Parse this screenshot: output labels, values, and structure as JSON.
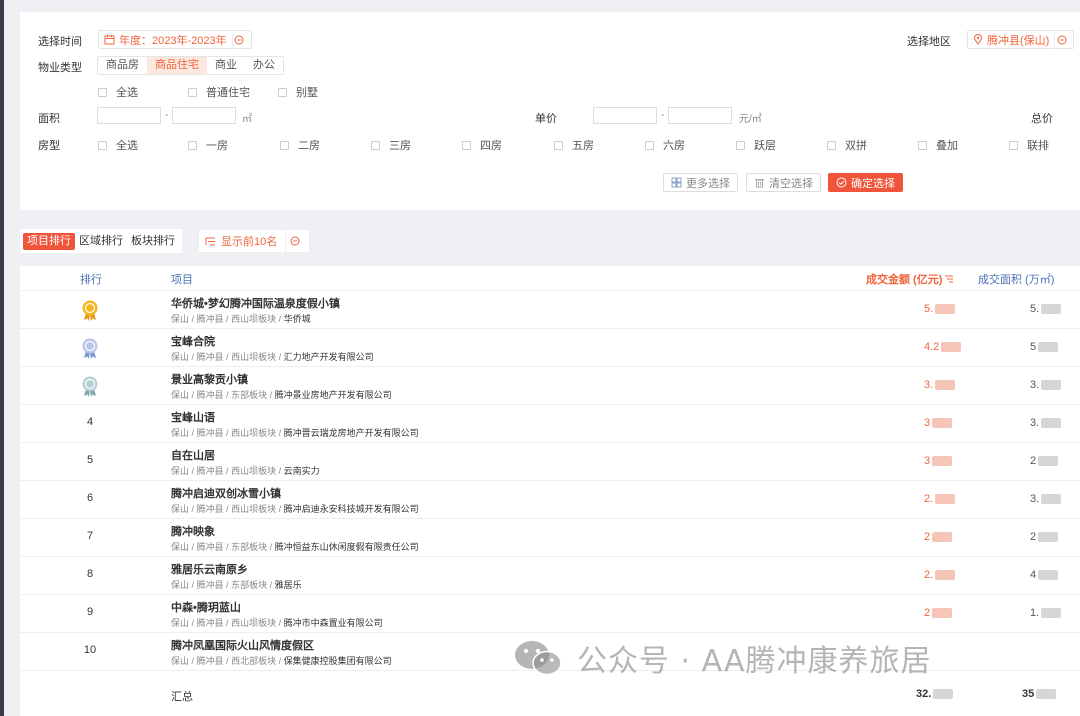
{
  "filters": {
    "time_label": "选择时间",
    "time_value": "年度：2023年-2023年",
    "region_label": "选择地区",
    "region_value": "腾冲县(保山)",
    "property_label": "物业类型",
    "property_types": [
      "商品房",
      "商品住宅",
      "商业",
      "办公"
    ],
    "property_active": "商品住宅",
    "sub_types": [
      "全选",
      "普通住宅",
      "别墅"
    ],
    "area_label": "面积",
    "area_unit": "㎡",
    "dash": "-",
    "price_label": "单价",
    "price_unit": "元/㎡",
    "total_label": "总价",
    "room_label": "房型",
    "rooms": [
      "全选",
      "一房",
      "二房",
      "三房",
      "四房",
      "五房",
      "六房",
      "跃层",
      "双拼",
      "叠加",
      "联排"
    ],
    "more_button": "更多选择",
    "clear_button": "清空选择",
    "confirm_button": "确定选择"
  },
  "tabs": {
    "items": [
      "项目排行",
      "区域排行",
      "板块排行"
    ],
    "active": "项目排行",
    "top_n": "显示前10名"
  },
  "table": {
    "headers": {
      "rank": "排行",
      "project": "项目",
      "amount": "成交金额 (亿元)",
      "area": "成交面积 (万㎡)"
    },
    "rows": [
      {
        "rank": "1",
        "medal": "gold",
        "name": "华侨城•梦幻腾冲国际温泉度假小镇",
        "city": "保山",
        "county": "腾冲县",
        "block": "西山坝板块",
        "dev": "华侨城",
        "amount": "5.",
        "area": "5."
      },
      {
        "rank": "2",
        "medal": "silver",
        "name": "宝峰合院",
        "city": "保山",
        "county": "腾冲县",
        "block": "西山坝板块",
        "dev": "汇力地产开发有限公司",
        "amount": "4.2",
        "area": "5"
      },
      {
        "rank": "3",
        "medal": "bronze",
        "name": "景业高黎贡小镇",
        "city": "保山",
        "county": "腾冲县",
        "block": "东部板块",
        "dev": "腾冲景业房地产开发有限公司",
        "amount": "3.",
        "area": "3."
      },
      {
        "rank": "4",
        "medal": "",
        "name": "宝峰山语",
        "city": "保山",
        "county": "腾冲县",
        "block": "西山坝板块",
        "dev": "腾冲晋云瑞龙房地产开发有限公司",
        "amount": "3",
        "area": "3."
      },
      {
        "rank": "5",
        "medal": "",
        "name": "自在山居",
        "city": "保山",
        "county": "腾冲县",
        "block": "西山坝板块",
        "dev": "云南实力",
        "amount": "3",
        "area": "2"
      },
      {
        "rank": "6",
        "medal": "",
        "name": "腾冲启迪双创冰雪小镇",
        "city": "保山",
        "county": "腾冲县",
        "block": "西山坝板块",
        "dev": "腾冲启迪永安科技城开发有限公司",
        "amount": "2.",
        "area": "3."
      },
      {
        "rank": "7",
        "medal": "",
        "name": "腾冲映象",
        "city": "保山",
        "county": "腾冲县",
        "block": "东部板块",
        "dev": "腾冲恒益东山休闲度假有限责任公司",
        "amount": "2",
        "area": "2"
      },
      {
        "rank": "8",
        "medal": "",
        "name": "雅居乐云南原乡",
        "city": "保山",
        "county": "腾冲县",
        "block": "东部板块",
        "dev": "雅居乐",
        "amount": "2.",
        "area": "4"
      },
      {
        "rank": "9",
        "medal": "",
        "name": "中森•腾玥蓝山",
        "city": "保山",
        "county": "腾冲县",
        "block": "西山坝板块",
        "dev": "腾冲市中森置业有限公司",
        "amount": "2",
        "area": "1."
      },
      {
        "rank": "10",
        "medal": "",
        "name": "腾冲凤凰国际火山风情度假区",
        "city": "保山",
        "county": "腾冲县",
        "block": "西北部板块",
        "dev": "保集健康控股集团有限公司",
        "amount": "",
        "area": ""
      }
    ],
    "total_label": "汇总",
    "total_amount": "32.",
    "total_area": "35"
  },
  "watermark": "公众号 · AA腾冲康养旅居",
  "colors": {
    "accent": "#f0543a",
    "header_blue": "#4a6fb5"
  }
}
